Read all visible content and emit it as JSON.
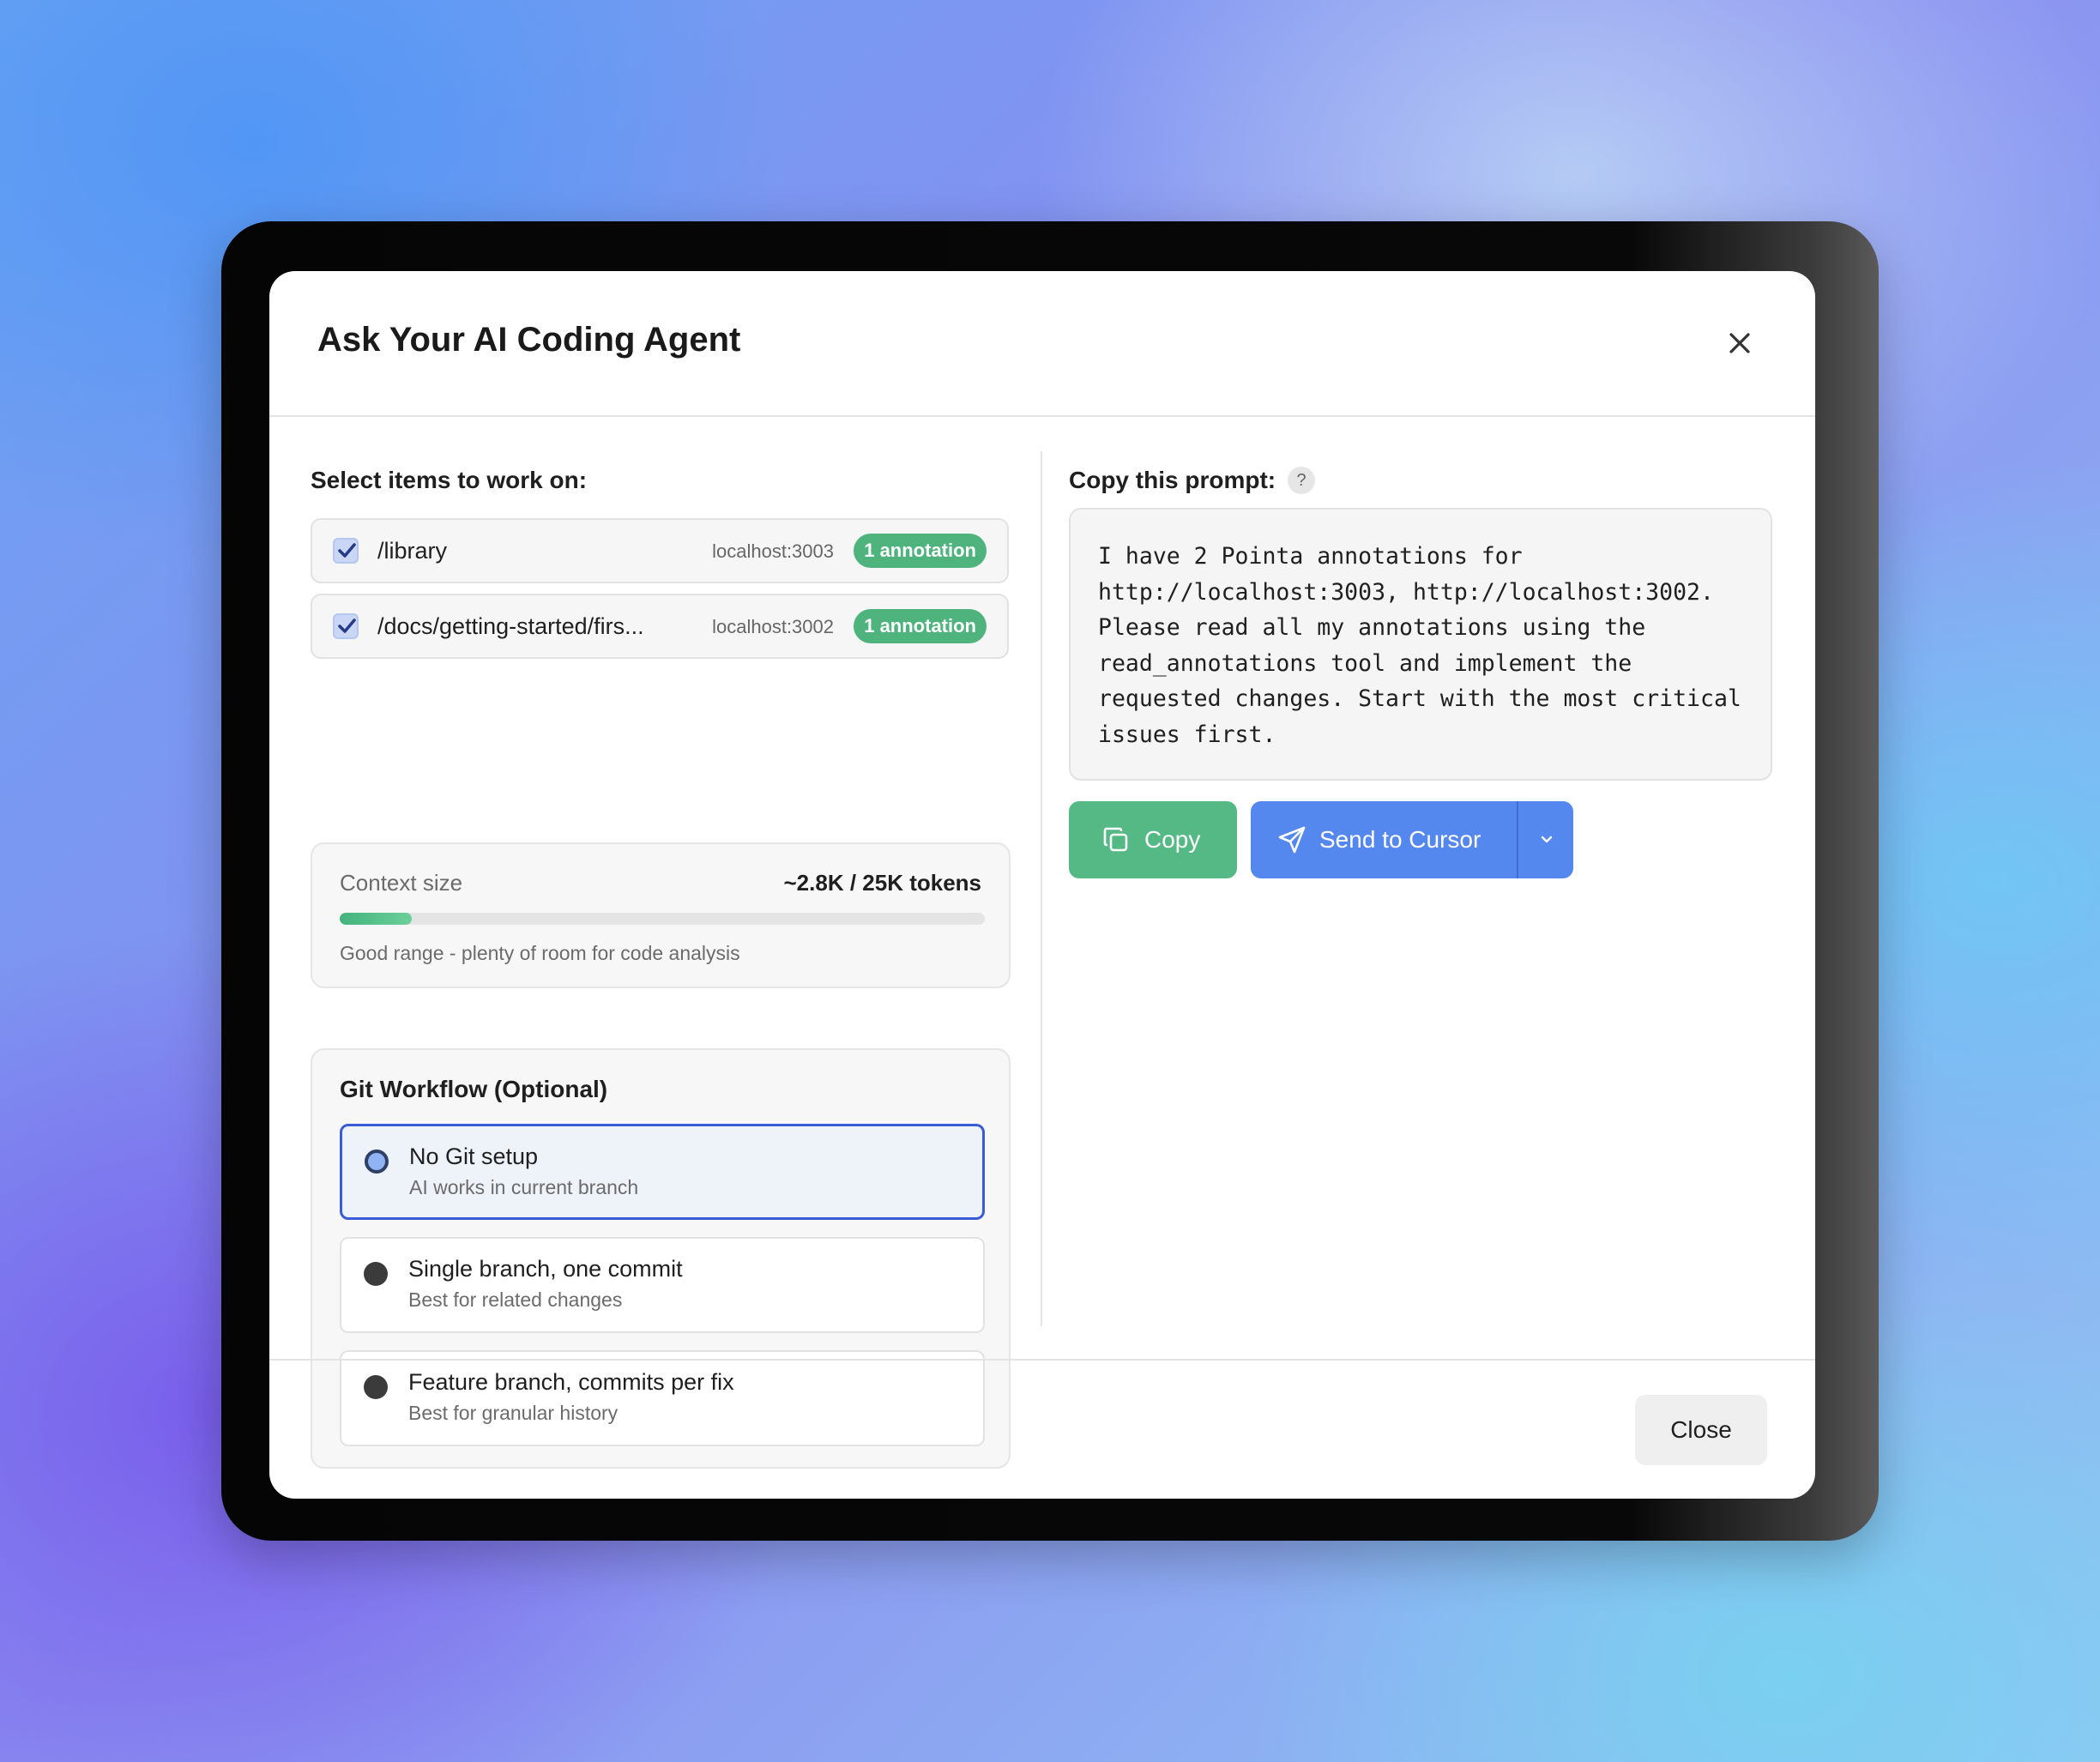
{
  "dialog": {
    "title": "Ask Your AI Coding Agent",
    "close_icon": "close-icon"
  },
  "items_section": {
    "label": "Select items to work on:",
    "items": [
      {
        "checked": true,
        "path": "/library",
        "host": "localhost:3003",
        "badge": "1 annotation"
      },
      {
        "checked": true,
        "path": "/docs/getting-started/firs...",
        "host": "localhost:3002",
        "badge": "1 annotation"
      }
    ]
  },
  "context": {
    "label": "Context size",
    "value": "~2.8K / 25K tokens",
    "progress_fraction": 0.112,
    "hint": "Good range - plenty of room for code analysis"
  },
  "git": {
    "title": "Git Workflow (Optional)",
    "options": [
      {
        "title": "No Git setup",
        "subtitle": "AI works in current branch",
        "selected": true
      },
      {
        "title": "Single branch, one commit",
        "subtitle": "Best for related changes",
        "selected": false
      },
      {
        "title": "Feature branch, commits per fix",
        "subtitle": "Best for granular history",
        "selected": false
      }
    ]
  },
  "prompt": {
    "label": "Copy this prompt:",
    "help": "?",
    "text": "I have 2 Pointa annotations for\nhttp://localhost:3003, http://localhost:3002.\nPlease read all my annotations using the\nread_annotations tool and implement the\nrequested changes. Start with the most critical\nissues first."
  },
  "actions": {
    "copy_label": "Copy",
    "copy_icon": "copy-icon",
    "send_label": "Send to Cursor",
    "send_icon": "paper-plane-icon",
    "dropdown_icon": "chevron-down-icon"
  },
  "footer": {
    "close_label": "Close"
  },
  "colors": {
    "accent_green": "#4fb37e",
    "accent_blue": "#5588ee",
    "selected_border": "#3a5bd6"
  }
}
